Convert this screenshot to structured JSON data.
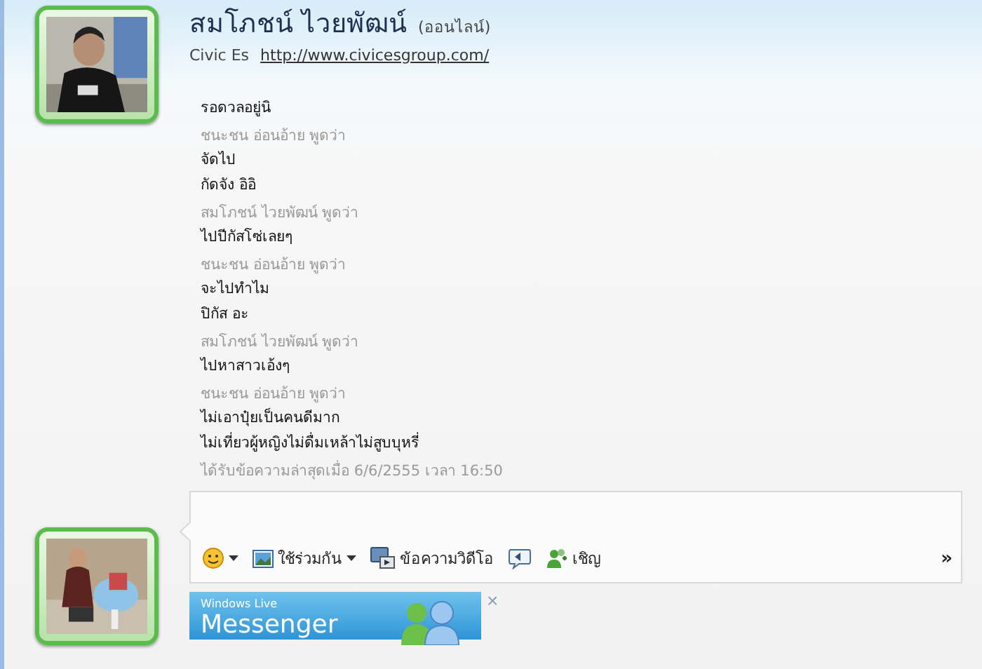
{
  "contact": {
    "name": "สมโภชน์ ไวยพัฒน์",
    "status": "(ออนไลน์)",
    "personal_message": "Civic Es",
    "link": "http://www.civicesgroup.com/"
  },
  "conversation": [
    {
      "lines": [
        "รอดวลอยู่นิ"
      ]
    },
    {
      "sender": "ชนะชน อ่อนอ้าย พูดว่า",
      "lines": [
        "จัดไป",
        "กัดจัง อิอิ"
      ]
    },
    {
      "sender": "สมโภชน์ ไวยพัฒน์ พูดว่า",
      "lines": [
        "ไปปีกัสโซ่เลยๆ"
      ]
    },
    {
      "sender": "ชนะชน อ่อนอ้าย พูดว่า",
      "lines": [
        "จะไปทำไม",
        "ปิกัส อะ"
      ]
    },
    {
      "sender": "สมโภชน์ ไวยพัฒน์ พูดว่า",
      "lines": [
        "ไปหาสาวเอ้งๆ"
      ]
    },
    {
      "sender": "ชนะชน อ่อนอ้าย พูดว่า",
      "lines": [
        "ไม่เอาปุ๋ยเป็นคนดีมาก",
        "ไม่เที่ยวผู้หญิงไม่ดื่มเหล้าไม่สูบบุหรี่"
      ]
    }
  ],
  "last_received": "ได้รับข้อความล่าสุดเมื่อ 6/6/2555 เวลา 16:50",
  "toolbar": [
    {
      "kind": "emoticon",
      "dropdown": true
    },
    {
      "kind": "share",
      "label": "ใช้ร่วมกัน",
      "dropdown": true
    },
    {
      "kind": "video",
      "label": "ข้อความวิดีโอ",
      "dropdown": false
    },
    {
      "kind": "nudge",
      "dropdown": false
    },
    {
      "kind": "invite",
      "label": "เชิญ",
      "dropdown": false
    }
  ],
  "more": "»",
  "ad": {
    "small": "Windows Live",
    "title": "Messenger",
    "close": "×"
  }
}
